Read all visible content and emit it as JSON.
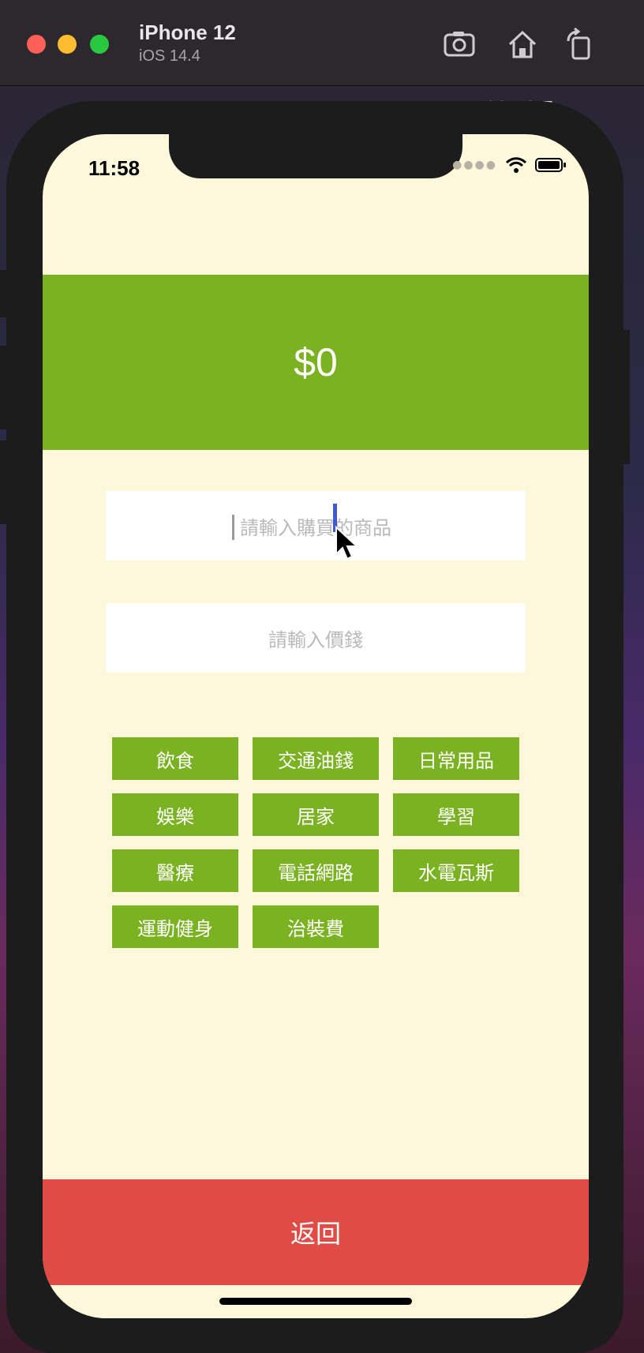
{
  "simulator": {
    "device_name": "iPhone 12",
    "os_version": "iOS 14.4"
  },
  "desktop": {
    "background_text": "109.12.5"
  },
  "status_bar": {
    "time": "11:58"
  },
  "app": {
    "amount": "$0",
    "item_input": {
      "placeholder": "請輸入購買的商品",
      "value": ""
    },
    "price_input": {
      "placeholder": "請輸入價錢",
      "value": ""
    },
    "categories": [
      "飲食",
      "交通油錢",
      "日常用品",
      "娛樂",
      "居家",
      "學習",
      "醫療",
      "電話網路",
      "水電瓦斯",
      "運動健身",
      "治裝費"
    ],
    "back_label": "返回"
  },
  "colors": {
    "green": "#7ab221",
    "red": "#e04c45",
    "screen_bg": "#fdf8dc"
  }
}
